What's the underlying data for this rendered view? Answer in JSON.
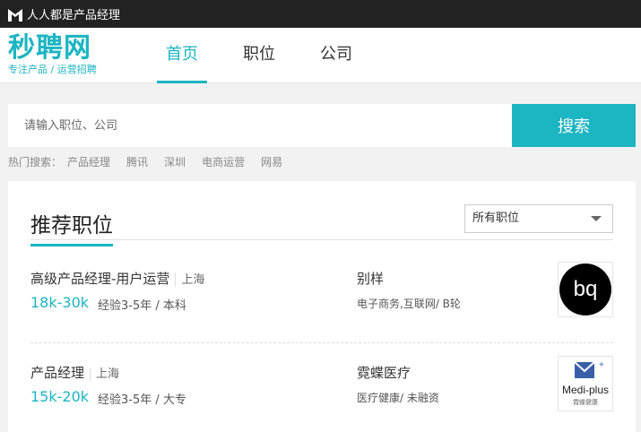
{
  "topbar": {
    "site_name": "人人都是产品经理"
  },
  "header": {
    "brand": "秒聘网",
    "slogan": "专注产品 / 运营招聘",
    "tabs": [
      {
        "label": "首页",
        "active": true
      },
      {
        "label": "职位",
        "active": false
      },
      {
        "label": "公司",
        "active": false
      }
    ]
  },
  "search": {
    "placeholder": "请输入职位、公司",
    "button_label": "搜索",
    "hot_label": "热门搜索：",
    "hot_items": [
      "产品经理",
      "腾讯",
      "深圳",
      "电商运营",
      "网易"
    ]
  },
  "panel": {
    "title": "推荐职位",
    "filter_value": "所有职位"
  },
  "jobs": [
    {
      "title": "高级产品经理-用户运营",
      "city": "上海",
      "salary": "18k-30k",
      "requirements": "经验3-5年 / 本科",
      "company": "别样",
      "industry": "电子商务,互联网/ B轮",
      "logo_text": "bq"
    },
    {
      "title": "产品经理",
      "city": "上海",
      "salary": "15k-20k",
      "requirements": "经验3-5年 / 大专",
      "company": "霓蝶医疗",
      "industry": "医疗健康/ 未融资",
      "logo_text": "Medi-plus",
      "logo_subtext": "霓蝶健康"
    }
  ],
  "colors": {
    "accent": "#1cb5c2",
    "topbar": "#222222"
  }
}
